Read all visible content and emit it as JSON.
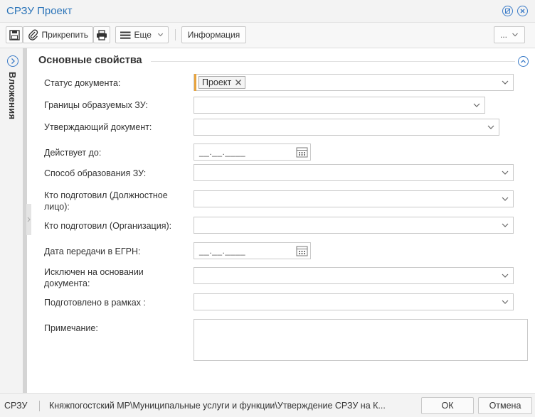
{
  "window": {
    "title": "СРЗУ Проект"
  },
  "toolbar": {
    "attach_label": "Прикрепить",
    "more_label": "Еще",
    "info_label": "Информация",
    "overflow_label": "..."
  },
  "sidebar": {
    "label": "Вложения"
  },
  "section": {
    "title": "Основные свойства"
  },
  "fields": {
    "doc_status": {
      "label": "Статус документа:",
      "tag": "Проект"
    },
    "boundaries": {
      "label": "Границы образуемых ЗУ:",
      "value": ""
    },
    "approving_doc": {
      "label": "Утверждающий документ:",
      "value": ""
    },
    "valid_until": {
      "label": "Действует до:",
      "mask": "__.__.____"
    },
    "formation_method": {
      "label": "Способ образования ЗУ:",
      "value": ""
    },
    "prepared_by_official": {
      "label": "Кто подготовил (Должностное лицо):",
      "value": ""
    },
    "prepared_by_org": {
      "label": "Кто подготовил (Организация):",
      "value": ""
    },
    "egrn_date": {
      "label": "Дата передачи в ЕГРН:",
      "mask": "__.__.____"
    },
    "excluded_basis": {
      "label": "Исключен на основании документа:",
      "value": ""
    },
    "prepared_within": {
      "label": "Подготовлено в рамках :",
      "value": ""
    },
    "note": {
      "label": "Примечание:",
      "value": ""
    }
  },
  "statusbar": {
    "code": "СРЗУ",
    "path": "Княжпогостский МР\\Муниципальные услуги и функции\\Утверждение СРЗУ на К...",
    "ok_label": "ОК",
    "cancel_label": "Отмена"
  },
  "colors": {
    "accent": "#2a73b8",
    "tag_marker": "#e8a33d"
  }
}
